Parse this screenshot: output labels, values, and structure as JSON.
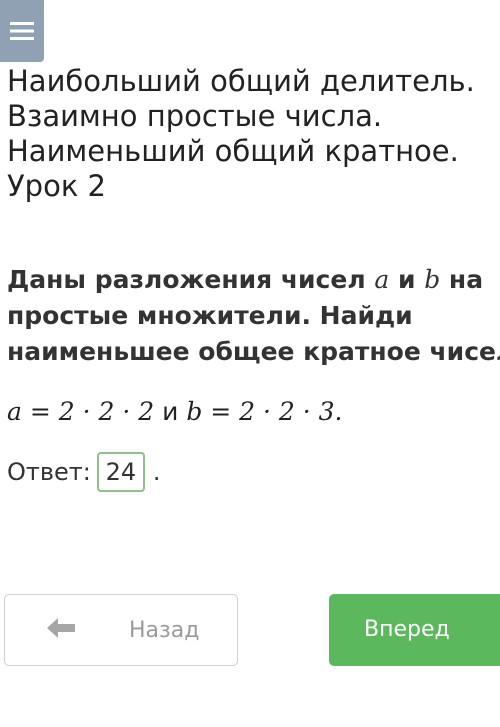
{
  "header": {
    "menu_icon": "hamburger-menu-icon",
    "menu_color": "#8fa1b3"
  },
  "lesson": {
    "title_lines": [
      "Наибольший общий делитель.",
      "Взаимно простые числа.",
      "Наименьший общий кратное.",
      "Урок 2"
    ]
  },
  "task": {
    "line1_prefix": "Даны разложения чисел ",
    "var_a": "a",
    "conj": " и ",
    "var_b": "b",
    "line1_suffix": " на",
    "line2": "простые множители. Найди",
    "line3": "наименьшее общее кратное чисел"
  },
  "formula": {
    "a_part": "a = 2 · 2 · 2",
    "conj": " и ",
    "b_part": "b = 2 · 2 · 3."
  },
  "answer": {
    "label": "Ответ:",
    "value": "24",
    "suffix": ".",
    "border_color": "#8cc28c"
  },
  "navigation": {
    "back_label": "Назад",
    "back_icon": "arrow-left-icon",
    "next_label": "Вперед",
    "next_color": "#5cb85c"
  }
}
